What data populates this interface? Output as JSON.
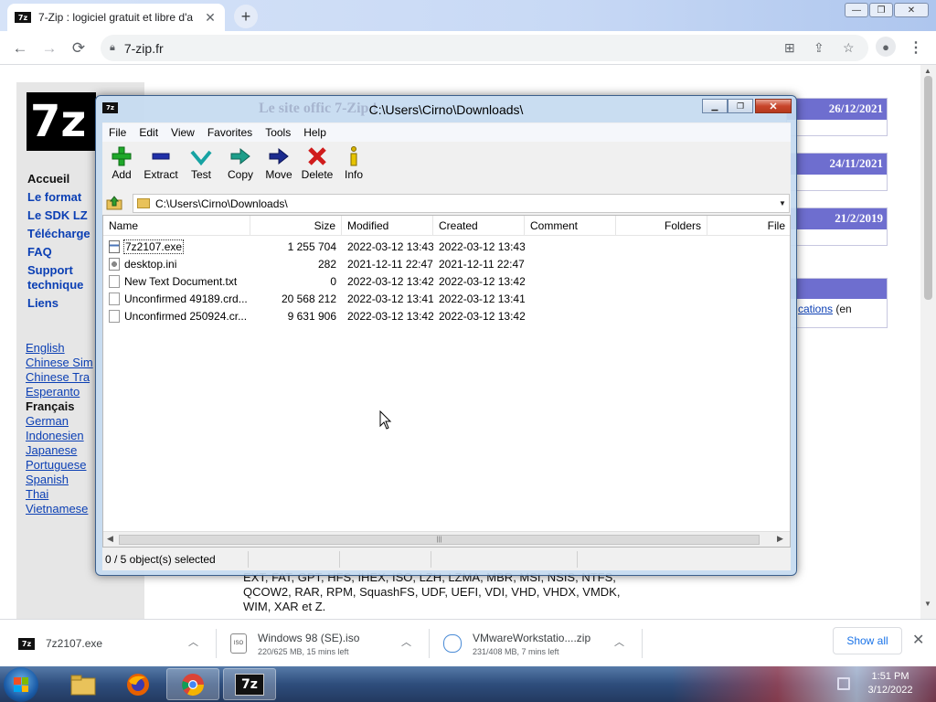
{
  "browser": {
    "tab_title": "7-Zip : logiciel gratuit et libre d'a",
    "tab_favicon": "7z",
    "address": "7-zip.fr"
  },
  "site": {
    "logo": "7z",
    "nav": [
      "Accueil",
      "Le format",
      "Le SDK LZ",
      "Télécharge",
      "FAQ",
      "Support",
      "technique",
      "Liens"
    ],
    "languages": [
      "English",
      "Chinese Sim",
      "Chinese Tra",
      "Esperanto",
      "Français",
      "German",
      "Indonesien",
      "Japanese",
      "Portuguese",
      "Spanish",
      "Thai",
      "Vietnamese"
    ],
    "news_dates": [
      "26/12/2021",
      "24/11/2021",
      "21/2/2019"
    ],
    "apps_link_text": "cations",
    "apps_after": " (en",
    "formats_text": [
      "EXT, FAT, GPT, HFS, IHEX, ISO, LZH, LZMA, MBR, MSI, NSIS, NTFS,",
      "QCOW2, RAR, RPM, SquashFS, UDF, UEFI, VDI, VHD, VHDX, VMDK,",
      "WIM, XAR et Z."
    ]
  },
  "sevenzip": {
    "title": "C:\\Users\\Cirno\\Downloads\\",
    "ghost_title": "Le site offic                              7-Zip !",
    "menu": [
      "File",
      "Edit",
      "View",
      "Favorites",
      "Tools",
      "Help"
    ],
    "toolbar": [
      "Add",
      "Extract",
      "Test",
      "Copy",
      "Move",
      "Delete",
      "Info"
    ],
    "path": "C:\\Users\\Cirno\\Downloads\\",
    "columns": [
      "Name",
      "Size",
      "Modified",
      "Created",
      "Comment",
      "Folders",
      "File"
    ],
    "files": [
      {
        "name": "7z2107.exe",
        "size": "1 255 704",
        "modified": "2022-03-12 13:43",
        "created": "2022-03-12 13:43"
      },
      {
        "name": "desktop.ini",
        "size": "282",
        "modified": "2021-12-11 22:47",
        "created": "2021-12-11 22:47"
      },
      {
        "name": "New Text Document.txt",
        "size": "0",
        "modified": "2022-03-12 13:42",
        "created": "2022-03-12 13:42"
      },
      {
        "name": "Unconfirmed 49189.crd...",
        "size": "20 568 212",
        "modified": "2022-03-12 13:41",
        "created": "2022-03-12 13:41"
      },
      {
        "name": "Unconfirmed 250924.cr...",
        "size": "9 631 906",
        "modified": "2022-03-12 13:42",
        "created": "2022-03-12 13:42"
      }
    ],
    "status": "0 / 5 object(s) selected"
  },
  "downloads": {
    "items": [
      {
        "name": "7z2107.exe",
        "status": ""
      },
      {
        "name": "Windows 98 (SE).iso",
        "status": "220/625 MB, 15 mins left"
      },
      {
        "name": "VMwareWorkstatio....zip",
        "status": "231/408 MB, 7 mins left"
      }
    ],
    "show_all": "Show all"
  },
  "taskbar": {
    "time": "1:51 PM",
    "date": "3/12/2022",
    "active_app_label": "7z"
  },
  "colors": {
    "site_blue": "#0b3fb4",
    "news_header": "#6e6ecf",
    "chrome_blue": "#1a73e8"
  }
}
